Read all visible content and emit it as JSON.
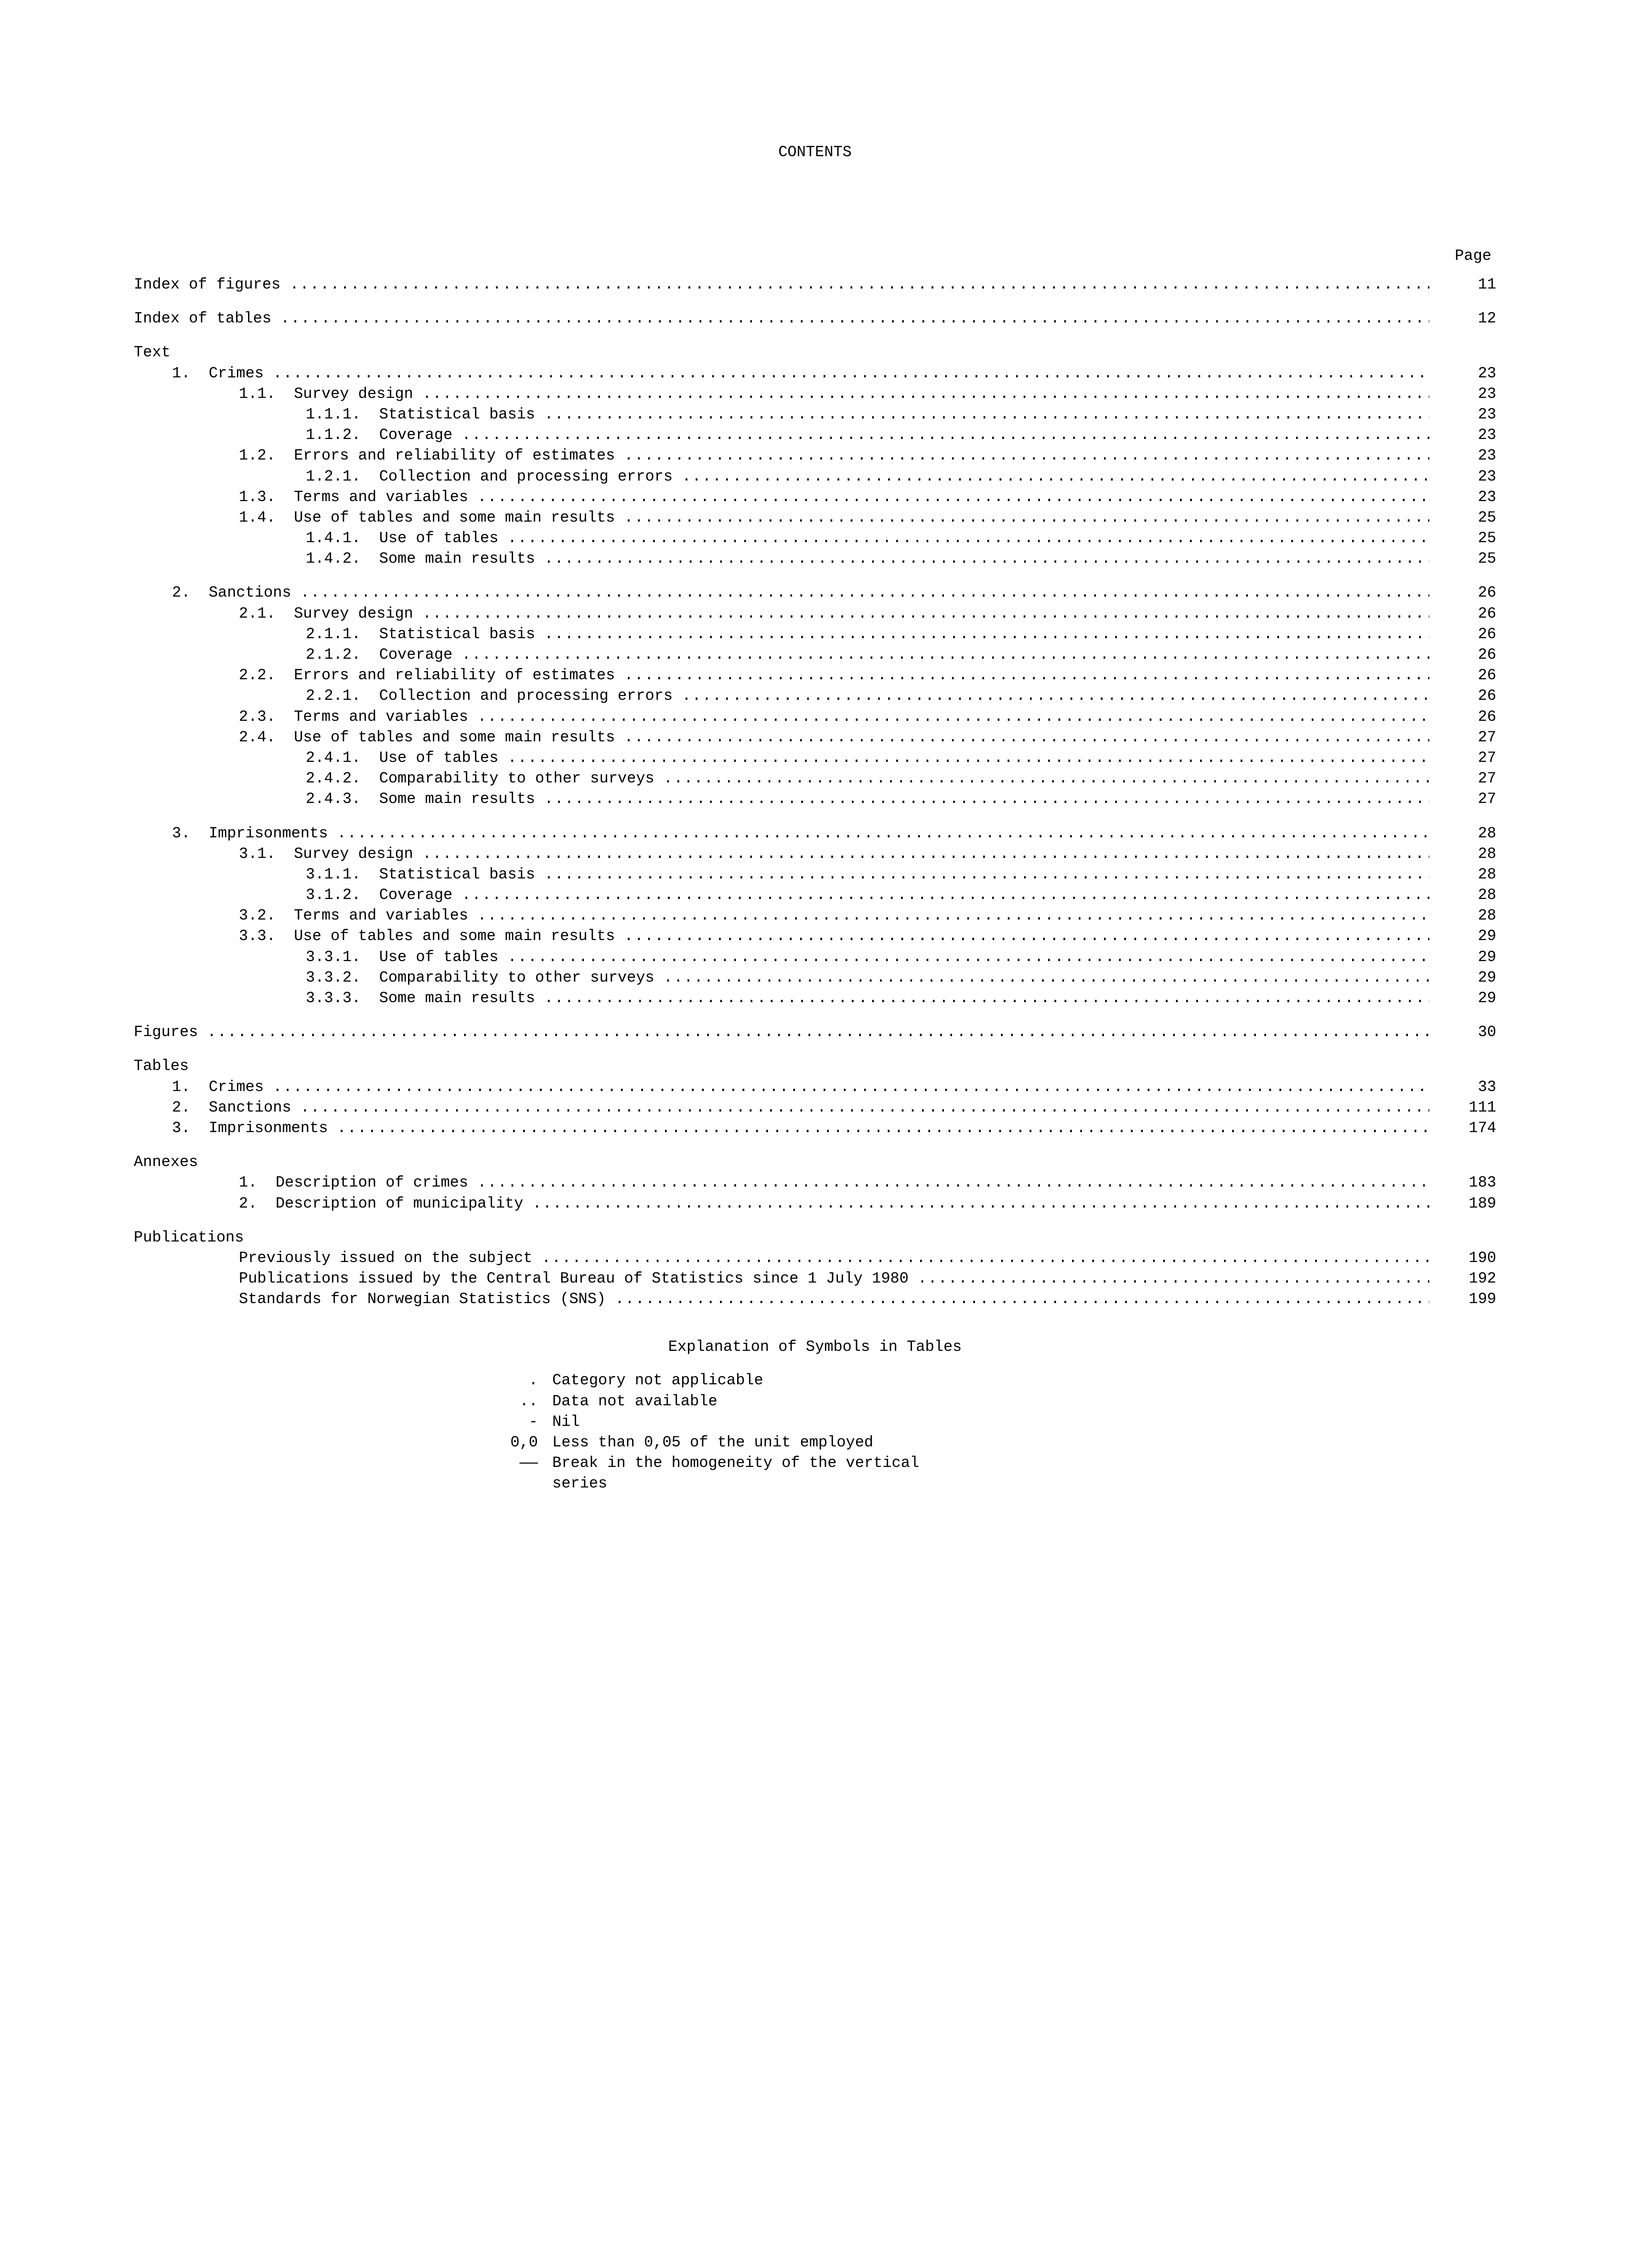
{
  "title": "CONTENTS",
  "page_header": "Page",
  "entries": [
    {
      "row": true,
      "indent": 0,
      "label": "Index of figures ",
      "page": "11"
    },
    {
      "spacer": true
    },
    {
      "row": true,
      "indent": 0,
      "label": "Index of tables ",
      "page": "12"
    },
    {
      "spacer": true
    },
    {
      "head": true,
      "indent": 0,
      "label": "Text"
    },
    {
      "row": true,
      "indent": 1,
      "label": "1.  Crimes ",
      "page": "23"
    },
    {
      "row": true,
      "indent": 2,
      "label": "1.1.  Survey design ",
      "page": "23"
    },
    {
      "row": true,
      "indent": 3,
      "label": "1.1.1.  Statistical basis ",
      "page": "23"
    },
    {
      "row": true,
      "indent": 3,
      "label": "1.1.2.  Coverage ",
      "page": "23"
    },
    {
      "row": true,
      "indent": 2,
      "label": "1.2.  Errors and reliability of estimates ",
      "page": "23"
    },
    {
      "row": true,
      "indent": 3,
      "label": "1.2.1.  Collection and processing errors ",
      "page": "23"
    },
    {
      "row": true,
      "indent": 2,
      "label": "1.3.  Terms and variables ",
      "page": "23"
    },
    {
      "row": true,
      "indent": 2,
      "label": "1.4.  Use of tables and some main results ",
      "page": "25"
    },
    {
      "row": true,
      "indent": 3,
      "label": "1.4.1.  Use of tables ",
      "page": "25"
    },
    {
      "row": true,
      "indent": 3,
      "label": "1.4.2.  Some main results ",
      "page": "25"
    },
    {
      "spacer": true
    },
    {
      "row": true,
      "indent": 1,
      "label": "2.  Sanctions ",
      "page": "26"
    },
    {
      "row": true,
      "indent": 2,
      "label": "2.1.  Survey design ",
      "page": "26"
    },
    {
      "row": true,
      "indent": 3,
      "label": "2.1.1.  Statistical basis ",
      "page": "26"
    },
    {
      "row": true,
      "indent": 3,
      "label": "2.1.2.  Coverage ",
      "page": "26"
    },
    {
      "row": true,
      "indent": 2,
      "label": "2.2.  Errors and reliability of estimates ",
      "page": "26"
    },
    {
      "row": true,
      "indent": 3,
      "label": "2.2.1.  Collection and processing errors ",
      "page": "26"
    },
    {
      "row": true,
      "indent": 2,
      "label": "2.3.  Terms and variables ",
      "page": "26"
    },
    {
      "row": true,
      "indent": 2,
      "label": "2.4.  Use of tables and some main results ",
      "page": "27"
    },
    {
      "row": true,
      "indent": 3,
      "label": "2.4.1.  Use of tables ",
      "page": "27"
    },
    {
      "row": true,
      "indent": 3,
      "label": "2.4.2.  Comparability to other surveys ",
      "page": "27"
    },
    {
      "row": true,
      "indent": 3,
      "label": "2.4.3.  Some main results ",
      "page": "27"
    },
    {
      "spacer": true
    },
    {
      "row": true,
      "indent": 1,
      "label": "3.  Imprisonments ",
      "page": "28"
    },
    {
      "row": true,
      "indent": 2,
      "label": "3.1.  Survey design ",
      "page": "28"
    },
    {
      "row": true,
      "indent": 3,
      "label": "3.1.1.  Statistical basis ",
      "page": "28"
    },
    {
      "row": true,
      "indent": 3,
      "label": "3.1.2.  Coverage ",
      "page": "28"
    },
    {
      "row": true,
      "indent": 2,
      "label": "3.2.  Terms and variables ",
      "page": "28"
    },
    {
      "row": true,
      "indent": 2,
      "label": "3.3.  Use of tables and some main results ",
      "page": "29"
    },
    {
      "row": true,
      "indent": 3,
      "label": "3.3.1.  Use of tables ",
      "page": "29"
    },
    {
      "row": true,
      "indent": 3,
      "label": "3.3.2.  Comparability to other surveys ",
      "page": "29"
    },
    {
      "row": true,
      "indent": 3,
      "label": "3.3.3.  Some main results ",
      "page": "29"
    },
    {
      "spacer": true
    },
    {
      "row": true,
      "indent": 0,
      "label": "Figures ",
      "page": "30"
    },
    {
      "spacer": true
    },
    {
      "head": true,
      "indent": 0,
      "label": "Tables"
    },
    {
      "row": true,
      "indent": 1,
      "label": "1.  Crimes ",
      "page": "33"
    },
    {
      "row": true,
      "indent": 1,
      "label": "2.  Sanctions ",
      "page": "111"
    },
    {
      "row": true,
      "indent": 1,
      "label": "3.  Imprisonments ",
      "page": "174"
    },
    {
      "spacer": true
    },
    {
      "head": true,
      "indent": 0,
      "label": "Annexes"
    },
    {
      "row": true,
      "indent": 2,
      "label": "1.  Description of crimes ",
      "page": "183"
    },
    {
      "row": true,
      "indent": 2,
      "label": "2.  Description of municipality ",
      "page": "189"
    },
    {
      "spacer": true
    },
    {
      "head": true,
      "indent": 0,
      "label": "Publications"
    },
    {
      "row": true,
      "indent": 2,
      "label": "Previously issued on the subject ",
      "page": "190"
    },
    {
      "row": true,
      "indent": 2,
      "label": "Publications issued by the Central Bureau of Statistics since 1 July 1980 ",
      "page": "192"
    },
    {
      "row": true,
      "indent": 2,
      "label": "Standards for Norwegian Statistics (SNS) ",
      "page": "199"
    }
  ],
  "symbols": {
    "title": "Explanation of Symbols in Tables",
    "rows": [
      {
        "mark": ".",
        "text": "Category not applicable"
      },
      {
        "mark": "..",
        "text": "Data not available"
      },
      {
        "mark": "-",
        "text": "Nil"
      },
      {
        "mark": "0,0",
        "text": "Less than 0,05 of the unit employed"
      },
      {
        "mark": "——",
        "text": "Break in the homogeneity of the vertical\nseries"
      }
    ]
  }
}
